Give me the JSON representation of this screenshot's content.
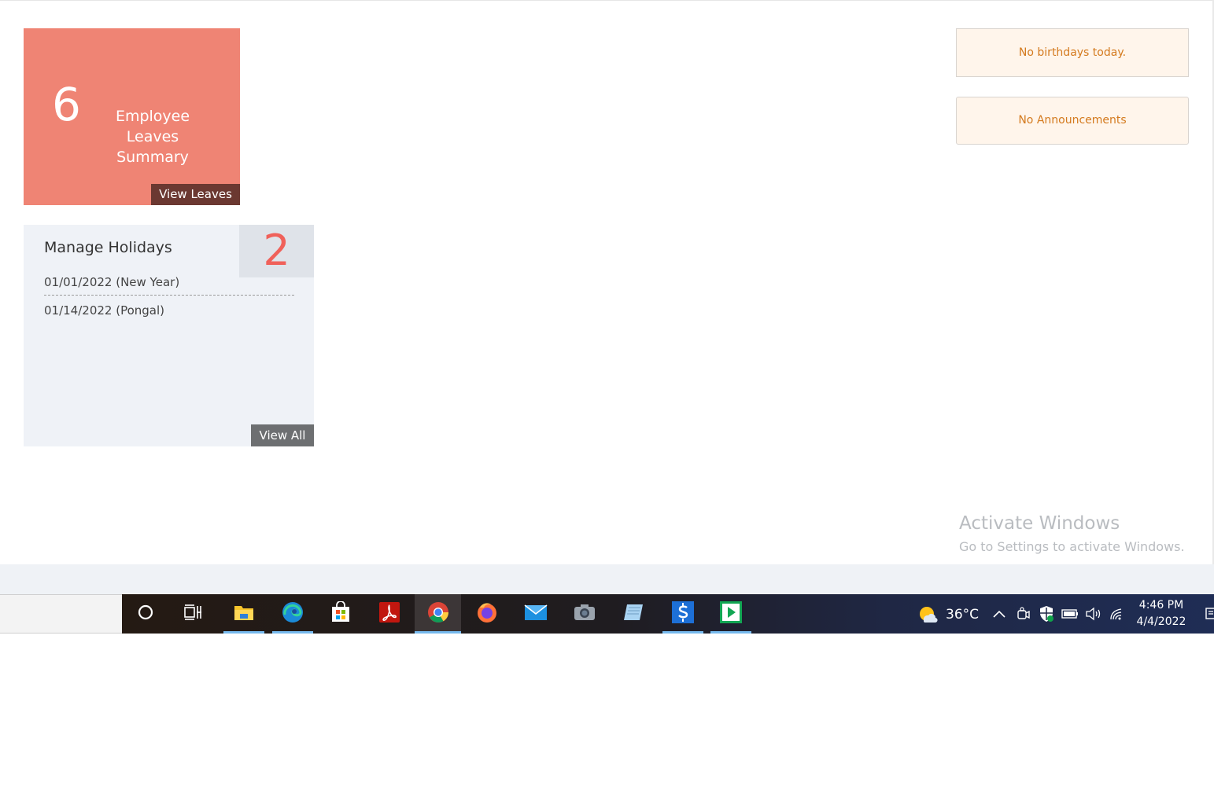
{
  "leaves_tile": {
    "count": "6",
    "label": "Employee Leaves Summary",
    "button": "View Leaves",
    "color": "#ef8474"
  },
  "holidays_tile": {
    "title": "Manage Holidays",
    "count": "2",
    "items": [
      "01/01/2022 (New Year)",
      "01/14/2022 (Pongal)"
    ],
    "button": "View All"
  },
  "notices": {
    "birthdays": "No birthdays today.",
    "announcements": "No Announcements"
  },
  "watermark": {
    "title": "Activate Windows",
    "subtitle": "Go to Settings to activate Windows."
  },
  "taskbar": {
    "apps": [
      "cortana-icon",
      "task-view-icon",
      "file-explorer-icon",
      "edge-icon",
      "store-icon",
      "acrobat-icon",
      "chrome-icon",
      "firefox-icon",
      "mail-icon",
      "camera-icon",
      "notes-icon",
      "skype-business-icon",
      "media-player-icon"
    ],
    "weather_temp": "36°C",
    "time": "4:46 PM",
    "date": "4/4/2022"
  }
}
